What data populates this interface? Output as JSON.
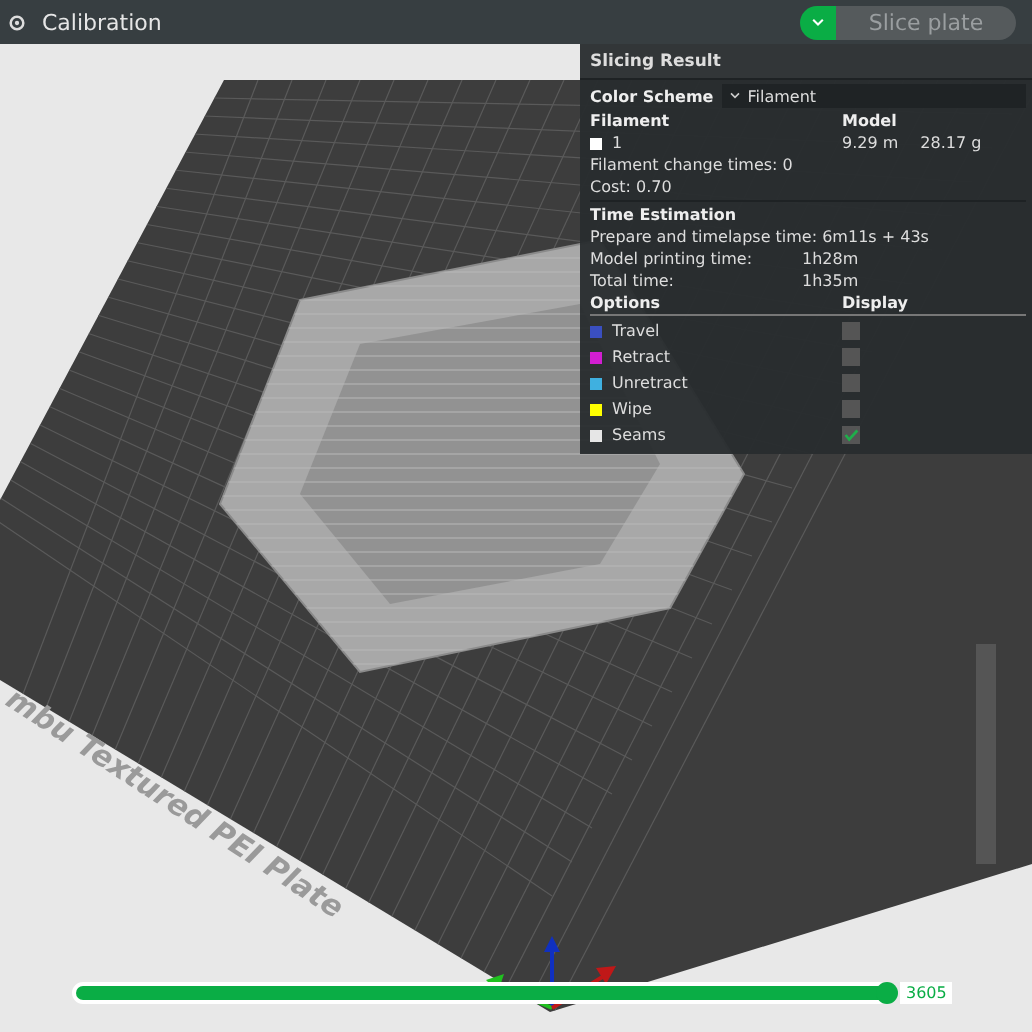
{
  "title_bar": {
    "title": "Calibration",
    "slice_button": {
      "label": "Slice plate",
      "disabled": true
    }
  },
  "viewport": {
    "plate_label": "mbu Textured PEI Plate"
  },
  "slicing_result": {
    "title": "Slicing Result",
    "color_scheme": {
      "label": "Color Scheme",
      "value": "Filament"
    },
    "filament_header": "Filament",
    "model_header": "Model",
    "filaments": [
      {
        "name": "1",
        "color": "#ffffff",
        "length": "9.29 m",
        "weight": "28.17 g"
      }
    ],
    "change_times": "Filament change times:  0",
    "cost": "Cost:  0.70",
    "time_title": "Time Estimation",
    "times": [
      {
        "label": "Prepare and timelapse time: 6m11s + 43s"
      },
      {
        "label": "Model printing time:",
        "value": "1h28m"
      },
      {
        "label": "Total time:",
        "value": "1h35m"
      }
    ],
    "options_header": "Options",
    "display_header": "Display",
    "options": [
      {
        "label": "Travel",
        "color": "#3a4fc0",
        "checked": false
      },
      {
        "label": "Retract",
        "color": "#d21ed2",
        "checked": false
      },
      {
        "label": "Unretract",
        "color": "#3fb0e0",
        "checked": false
      },
      {
        "label": "Wipe",
        "color": "#ffff00",
        "checked": false
      },
      {
        "label": "Seams",
        "color": "#e6e6e6",
        "checked": true
      }
    ]
  },
  "layer_slider": {
    "level": 1,
    "value": "3605"
  }
}
